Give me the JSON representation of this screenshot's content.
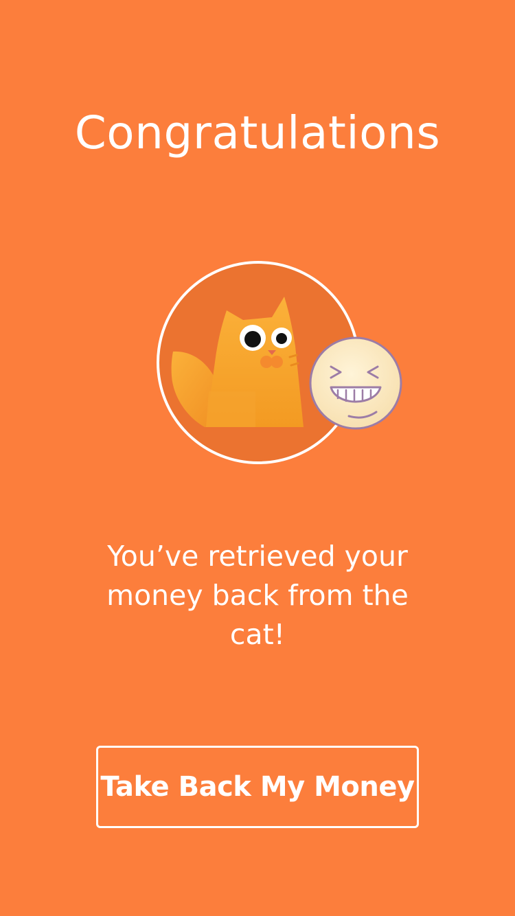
{
  "screen": {
    "background_color": "#FC7E3C",
    "title": "Congratulations",
    "message": "You’ve retrieved your money back from the cat!",
    "illustration": {
      "cat_icon": "cat-icon",
      "emoji_icon": "laughing-face-icon"
    },
    "button_label": "Take Back My Money"
  }
}
